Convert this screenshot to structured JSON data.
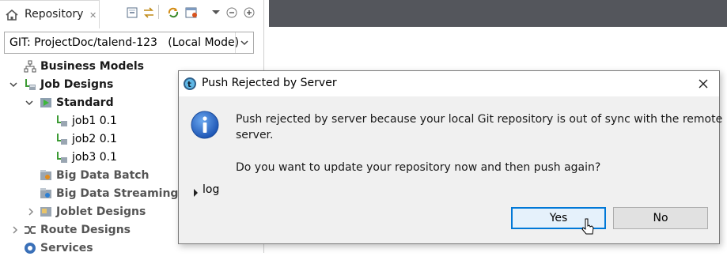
{
  "repository_panel": {
    "tab_label": "Repository",
    "git_selector_value": "GIT: ProjectDoc/talend-123   (Local Mode)",
    "tree": [
      {
        "label": "Business Models",
        "icon": "hierarchy-icon",
        "expander": "none"
      },
      {
        "label": "Job Designs",
        "icon": "job-folder-icon",
        "expander": "expanded"
      },
      {
        "label": "Standard",
        "icon": "standard-folder-icon",
        "expander": "expanded"
      },
      {
        "label": "job1 0.1",
        "icon": "job-icon",
        "expander": "none"
      },
      {
        "label": "job2 0.1",
        "icon": "job-icon",
        "expander": "none"
      },
      {
        "label": "job3 0.1",
        "icon": "job-icon",
        "expander": "none"
      },
      {
        "label": "Big Data Batch",
        "icon": "big-data-batch-icon",
        "expander": "none"
      },
      {
        "label": "Big Data Streaming",
        "icon": "big-data-streaming-icon",
        "expander": "none"
      },
      {
        "label": "Joblet Designs",
        "icon": "joblet-icon",
        "expander": "collapsed"
      },
      {
        "label": "Route Designs",
        "icon": "route-icon",
        "expander": "collapsed"
      },
      {
        "label": "Services",
        "icon": "services-icon",
        "expander": "none"
      }
    ]
  },
  "dialog": {
    "title": "Push Rejected by Server",
    "message_line1": "Push rejected by server because your local Git repository is out of sync with the remote",
    "message_line2": "server.",
    "question": "Do you want to update your repository now and then push again?",
    "log_label": "log",
    "yes_label": "Yes",
    "no_label": "No"
  },
  "colors": {
    "editor_bar": "#54565c",
    "info_icon": "#1f5fbf",
    "primary_button_border": "#0078d7"
  }
}
